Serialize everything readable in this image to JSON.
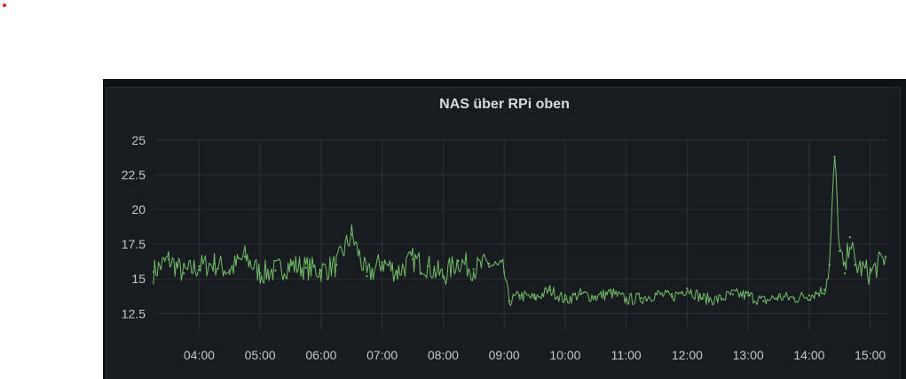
{
  "panel": {
    "title": "NAS über RPi oben"
  },
  "colors": {
    "series": "#73bf69",
    "background": "#181b1f",
    "grid": "#2f3136",
    "text": "#c7c7cc"
  },
  "chart_data": {
    "type": "line",
    "title": "NAS über RPi oben",
    "xlabel": "",
    "ylabel": "",
    "ylim": [
      11.3,
      25
    ],
    "xlim": [
      "03:16",
      "15:16"
    ],
    "grid": true,
    "legend": "none",
    "y_ticks": [
      "25",
      "22.5",
      "20",
      "17.5",
      "15",
      "12.5"
    ],
    "x_ticks": [
      "04:00",
      "05:00",
      "06:00",
      "07:00",
      "08:00",
      "09:00",
      "10:00",
      "11:00",
      "12:00",
      "13:00",
      "14:00",
      "15:00"
    ],
    "series": [
      {
        "x": [
          "03:15",
          "03:30",
          "03:45",
          "04:00",
          "04:15",
          "04:30",
          "04:45",
          "05:00",
          "05:15",
          "05:30",
          "05:45",
          "06:00",
          "06:15",
          "06:30",
          "06:45",
          "07:00",
          "07:15",
          "07:30",
          "07:45",
          "08:00",
          "08:15",
          "08:30",
          "08:45",
          "09:00",
          "09:05",
          "09:15",
          "09:30",
          "09:45",
          "10:00",
          "10:15",
          "10:30",
          "10:45",
          "11:00",
          "11:15",
          "11:30",
          "11:45",
          "12:00",
          "12:15",
          "12:30",
          "12:45",
          "13:00",
          "13:15",
          "13:30",
          "13:45",
          "14:00",
          "14:15",
          "14:20",
          "14:25",
          "14:30",
          "14:35",
          "14:40",
          "14:45",
          "15:00",
          "15:15"
        ],
        "y": [
          15.5,
          16.4,
          15.4,
          15.9,
          16.1,
          15.6,
          16.6,
          15.4,
          15.6,
          16.0,
          15.8,
          15.6,
          16.0,
          18.2,
          15.2,
          16.2,
          15.5,
          16.4,
          15.9,
          15.2,
          16.3,
          15.7,
          16.1,
          15.5,
          13.4,
          13.8,
          13.6,
          14.2,
          13.5,
          13.9,
          13.7,
          14.0,
          13.5,
          13.6,
          13.9,
          13.7,
          14.3,
          13.6,
          13.5,
          13.9,
          13.8,
          13.4,
          13.7,
          13.6,
          13.8,
          14.2,
          16.0,
          23.8,
          17.0,
          15.4,
          18.0,
          16.0,
          15.4,
          16.6
        ]
      }
    ]
  }
}
